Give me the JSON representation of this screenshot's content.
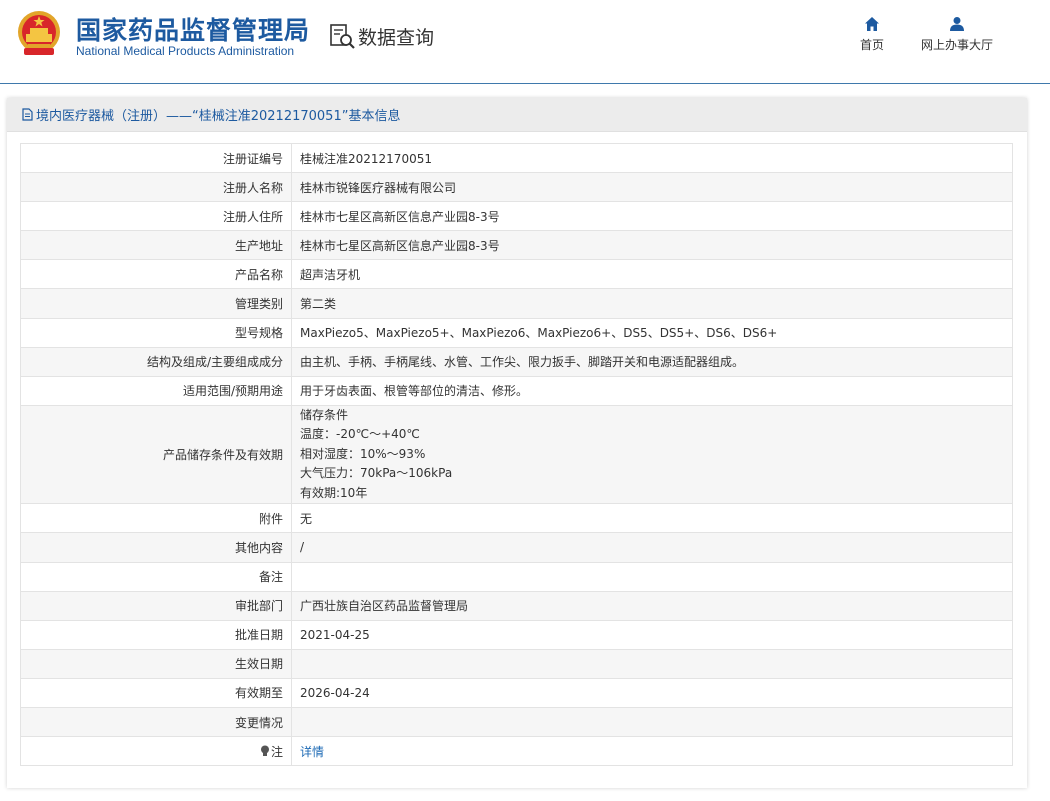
{
  "header": {
    "brand_cn": "国家药品监督管理局",
    "brand_en": "National Medical Products Administration",
    "query_label": "数据查询",
    "nav": {
      "home": "首页",
      "online_hall": "网上办事大厅"
    },
    "accent_color": "#1d5aa0"
  },
  "panel": {
    "title": "境内医疗器械（注册）——“桂械注准20212170051”基本信息"
  },
  "rows": [
    {
      "label": "注册证编号",
      "value": "桂械注准20212170051"
    },
    {
      "label": "注册人名称",
      "value": "桂林市锐锋医疗器械有限公司"
    },
    {
      "label": "注册人住所",
      "value": "桂林市七星区高新区信息产业园8-3号"
    },
    {
      "label": "生产地址",
      "value": "桂林市七星区高新区信息产业园8-3号"
    },
    {
      "label": "产品名称",
      "value": "超声洁牙机"
    },
    {
      "label": "管理类别",
      "value": "第二类"
    },
    {
      "label": "型号规格",
      "value": "MaxPiezo5、MaxPiezo5+、MaxPiezo6、MaxPiezo6+、DS5、DS5+、DS6、DS6+"
    },
    {
      "label": "结构及组成/主要组成成分",
      "value": "由主机、手柄、手柄尾线、水管、工作尖、限力扳手、脚踏开关和电源适配器组成。"
    },
    {
      "label": "适用范围/预期用途",
      "value": "用于牙齿表面、根管等部位的清洁、修形。"
    },
    {
      "label": "产品储存条件及有效期",
      "lines": [
        "储存条件",
        "温度：-20℃～+40℃",
        "相对湿度：10%～93%",
        "大气压力：70kPa～106kPa",
        "有效期:10年"
      ]
    },
    {
      "label": "附件",
      "value": "无"
    },
    {
      "label": "其他内容",
      "value": "/"
    },
    {
      "label": "备注",
      "value": ""
    },
    {
      "label": "审批部门",
      "value": "广西壮族自治区药品监督管理局"
    },
    {
      "label": "批准日期",
      "value": "2021-04-25"
    },
    {
      "label": "生效日期",
      "value": ""
    },
    {
      "label": "有效期至",
      "value": "2026-04-24"
    },
    {
      "label": "变更情况",
      "value": ""
    },
    {
      "label": "注",
      "value": "详情",
      "icon": "note-bulb-icon"
    }
  ]
}
